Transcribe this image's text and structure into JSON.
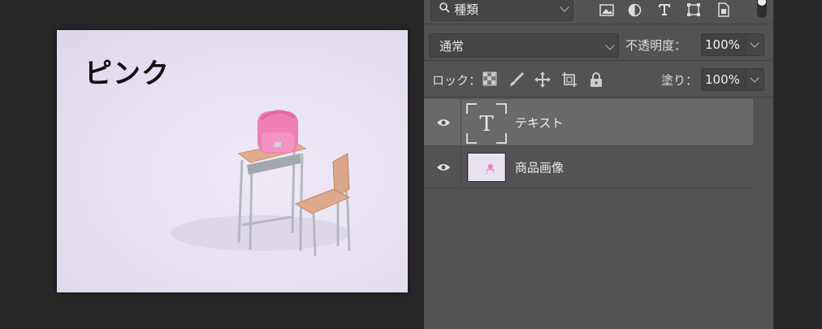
{
  "canvas": {
    "overlay_text": "ピンク",
    "image_subject": "pink school backpack on small school desk with chair"
  },
  "layers_panel": {
    "filter": {
      "search_icon": "magnifier-icon",
      "kind_label": "種類",
      "filter_icons": [
        "image-filter-icon",
        "adjustment-filter-icon",
        "type-filter-icon",
        "shape-filter-icon",
        "smart-object-filter-icon"
      ],
      "toggle": "on"
    },
    "blend": {
      "mode": "通常",
      "opacity_label": "不透明度：",
      "opacity_value": "100%"
    },
    "lock": {
      "label": "ロック：",
      "lock_icons": [
        "lock-transparent-icon",
        "lock-paint-icon",
        "lock-position-icon",
        "lock-artboard-icon",
        "lock-all-icon"
      ],
      "fill_label": "塗り：",
      "fill_value": "100%"
    },
    "layers": [
      {
        "name": "テキスト",
        "type": "text",
        "visible": true,
        "selected": true,
        "thumb_glyph": "T"
      },
      {
        "name": "商品画像",
        "type": "image",
        "visible": true,
        "selected": false
      }
    ]
  },
  "colors": {
    "app_background": "#282828",
    "panel": "#535353",
    "selected_layer": "#696969",
    "canvas_tint": "#e8e1f1",
    "backpack": "#f07fb4"
  }
}
